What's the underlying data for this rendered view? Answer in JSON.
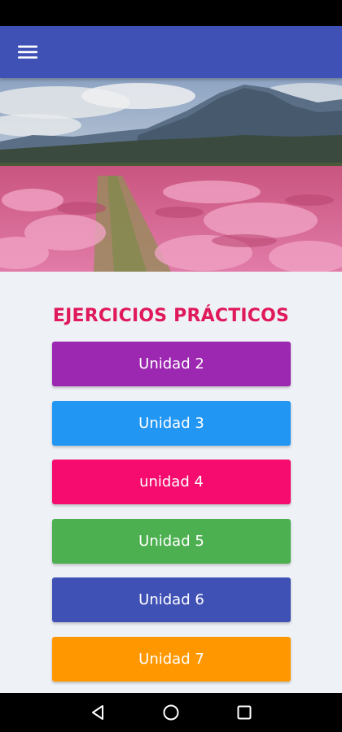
{
  "app_bar": {
    "color": "#3f51b5",
    "menu_icon": "hamburger-menu-icon"
  },
  "hero": {
    "image": "pink blossoming orchard field with mountains"
  },
  "main": {
    "title": "EJERCICIOS PRÁCTICOS",
    "title_color": "#e0195a",
    "buttons": [
      {
        "label": "Unidad 2",
        "color": "#9c27b0"
      },
      {
        "label": "Unidad 3",
        "color": "#2196f3"
      },
      {
        "label": "unidad 4",
        "color": "#f50c6e"
      },
      {
        "label": "Unidad 5",
        "color": "#4caf50"
      },
      {
        "label": "Unidad 6",
        "color": "#3f51b5"
      },
      {
        "label": "Unidad 7",
        "color": "#ff9800"
      }
    ]
  },
  "system_nav": {
    "back_icon": "back-triangle-icon",
    "home_icon": "home-circle-icon",
    "recents_icon": "recents-square-icon"
  }
}
